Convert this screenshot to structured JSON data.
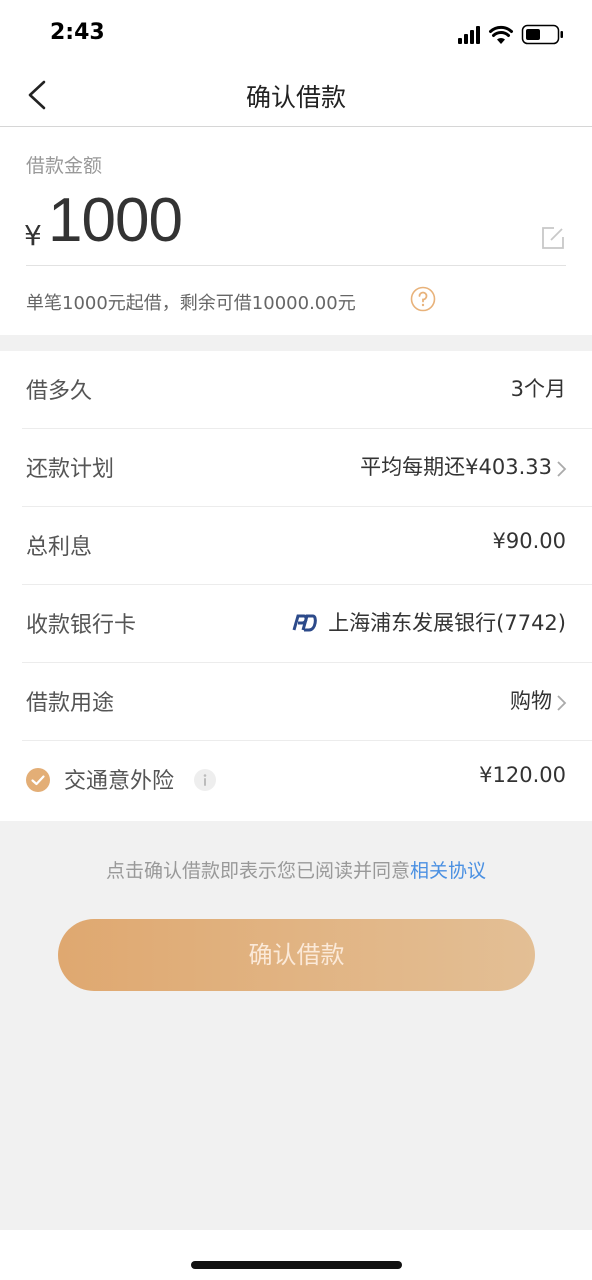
{
  "status_bar": {
    "time": "2:43"
  },
  "nav": {
    "title": "确认借款"
  },
  "amount_section": {
    "label": "借款金额",
    "currency": "¥",
    "amount": "1000",
    "hint": "单笔1000元起借，剩余可借10000.00元"
  },
  "rows": {
    "duration": {
      "label": "借多久",
      "value": "3个月"
    },
    "repay_plan": {
      "label": "还款计划",
      "value": "平均每期还¥403.33"
    },
    "interest": {
      "label": "总利息",
      "value": "¥90.00"
    },
    "bank_card": {
      "label": "收款银行卡",
      "value": "上海浦东发展银行(7742)"
    },
    "purpose": {
      "label": "借款用途",
      "value": "购物"
    },
    "insurance": {
      "label": "交通意外险",
      "value": "¥120.00",
      "checked": true
    }
  },
  "agreement": {
    "text": "点击确认借款即表示您已阅读并同意",
    "link": "相关协议"
  },
  "confirm_button": {
    "label": "确认借款"
  },
  "colors": {
    "accent": "#E3AE76",
    "link": "#4A90E2",
    "bank_logo": "#2C4A8A"
  }
}
